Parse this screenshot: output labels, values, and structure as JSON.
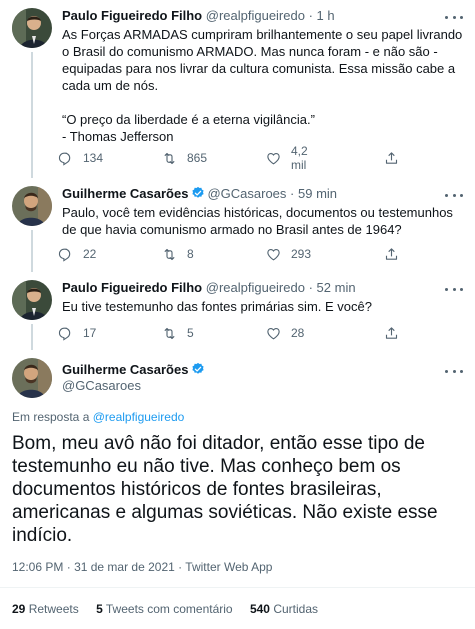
{
  "colors": {
    "accent": "#1d9bf0",
    "text_primary": "#0f1419",
    "text_secondary": "#536471",
    "divider": "#eff3f4",
    "thread_line": "#cfd9de"
  },
  "tweets": [
    {
      "name": "Paulo Figueiredo Filho",
      "handle": "@realpfigueiredo",
      "separator": "·",
      "time": "1 h",
      "verified": false,
      "text_p1": "As Forças ARMADAS cumpriram brilhantemente o seu papel livrando o Brasil do comunismo ARMADO. Mas nunca foram - e não são - equipadas para nos livrar da cultura comunista. Essa missão cabe a cada um de nós.",
      "text_p2": "“O preço da liberdade é a eterna vigilância.”",
      "text_p3": "- Thomas Jefferson",
      "replies": "134",
      "retweets": "865",
      "likes": "4,2 mil",
      "avatar_icon": "user-avatar-icon"
    },
    {
      "name": "Guilherme Casarões",
      "handle": "@GCasaroes",
      "separator": "·",
      "time": "59 min",
      "verified": true,
      "text": "Paulo, você tem evidências históricas, documentos ou testemunhos de que havia comunismo armado no Brasil antes de 1964?",
      "replies": "22",
      "retweets": "8",
      "likes": "293",
      "avatar_icon": "user-avatar-icon"
    },
    {
      "name": "Paulo Figueiredo Filho",
      "handle": "@realpfigueiredo",
      "separator": "·",
      "time": "52 min",
      "verified": false,
      "text": "Eu tive testemunho das fontes primárias sim. E você?",
      "replies": "17",
      "retweets": "5",
      "likes": "28",
      "avatar_icon": "user-avatar-icon"
    }
  ],
  "main_tweet": {
    "name": "Guilherme Casarões",
    "handle": "@GCasaroes",
    "verified": true,
    "reply_prefix": "Em resposta a",
    "reply_handle": "@realpfigueiredo",
    "text": "Bom, meu avô não foi ditador, então esse tipo de testemunho eu não tive. Mas conheço bem os documentos históricos de fontes brasileiras, americanas e algumas soviéticas. Não existe esse indício.",
    "time": "12:06 PM",
    "date": "31 de mar de 2021",
    "source": "Twitter Web App",
    "separator": "·",
    "retweets_count": "29",
    "retweets_label": "Retweets",
    "quotes_count": "5",
    "quotes_label": "Tweets com comentário",
    "likes_count": "540",
    "likes_label": "Curtidas"
  }
}
